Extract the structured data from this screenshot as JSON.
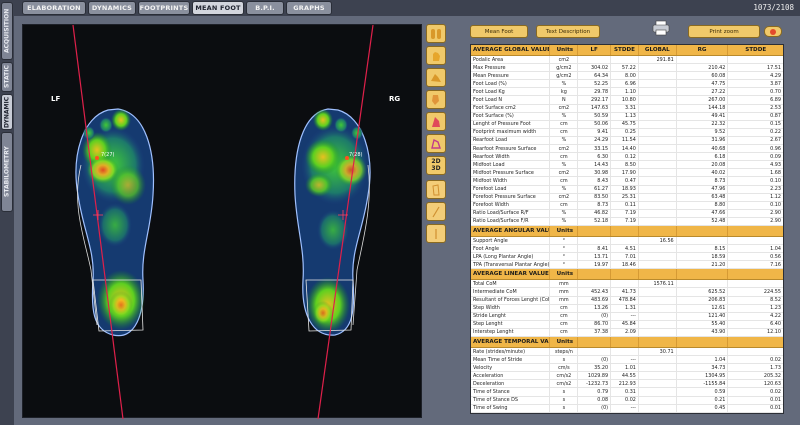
{
  "side_tabs": [
    {
      "label": "ACQUISITION",
      "active": false
    },
    {
      "label": "STATIC",
      "active": false
    },
    {
      "label": "DYNAMIC",
      "active": true
    },
    {
      "label": "STABILOMETRY",
      "active": false
    }
  ],
  "top_tabs": [
    {
      "label": "ELABORATION",
      "active": false
    },
    {
      "label": "DYNAMICS",
      "active": false
    },
    {
      "label": "FOOTPRINTS",
      "active": false
    },
    {
      "label": "MEAN FOOT",
      "active": true
    },
    {
      "label": "B.P.I.",
      "active": false
    },
    {
      "label": "GRAPHS",
      "active": false
    }
  ],
  "frame_counter": "1073/2108",
  "footprint_view": {
    "left_label": "LF",
    "right_label": "RG",
    "left_marker": "7(27)",
    "right_marker": "7(28)"
  },
  "buttons": {
    "mean_foot": "Mean Foot",
    "text_description": "Text Description",
    "print_zoom": "Print zoom",
    "view_2d": "2D",
    "view_3d": "3D"
  },
  "table": {
    "sections": [
      {
        "title": "AVERAGE GLOBAL VALUE",
        "columns": [
          "Units",
          "LF",
          "STDDE",
          "GLOBAL",
          "RG",
          "STDDE"
        ],
        "rows": [
          [
            "Podalic Area",
            "cm2",
            "",
            "",
            "291.81",
            "",
            ""
          ],
          [
            "Max Pressure",
            "g/cm2",
            "304.02",
            "57.22",
            "",
            "210.42",
            "17.51"
          ],
          [
            "Mean Pressure",
            "g/cm2",
            "64.34",
            "8.00",
            "",
            "60.08",
            "4.29"
          ],
          [
            "Foot Load (%)",
            "%",
            "52.25",
            "6.96",
            "",
            "47.75",
            "3.87"
          ],
          [
            "Foot Load Kg",
            "kg",
            "29.78",
            "1.10",
            "",
            "27.22",
            "0.70"
          ],
          [
            "Foot Load N",
            "N",
            "292.17",
            "10.80",
            "",
            "267.00",
            "6.89"
          ],
          [
            "Foot Surface cm2",
            "cm2",
            "147.63",
            "3.31",
            "",
            "144.18",
            "2.53"
          ],
          [
            "Foot Surface (%)",
            "%",
            "50.59",
            "1.13",
            "",
            "49.41",
            "0.87"
          ],
          [
            "Lenght of Pressure Foot",
            "cm",
            "50.06",
            "45.75",
            "",
            "22.32",
            "0.15"
          ],
          [
            "Footprint maximum width",
            "cm",
            "9.41",
            "0.25",
            "",
            "9.52",
            "0.22"
          ],
          [
            "Rearfoot Load",
            "%",
            "24.29",
            "11.54",
            "",
            "31.96",
            "2.67"
          ],
          [
            "Rearfoot Pressure Surface",
            "cm2",
            "33.15",
            "14.40",
            "",
            "40.68",
            "0.96"
          ],
          [
            "Rearfoot Width",
            "cm",
            "6.30",
            "0.12",
            "",
            "6.18",
            "0.09"
          ],
          [
            "Midfoot Load",
            "%",
            "14.43",
            "8.50",
            "",
            "20.08",
            "4.93"
          ],
          [
            "Midfoot Pressure Surface",
            "cm2",
            "30.98",
            "17.90",
            "",
            "40.02",
            "1.68"
          ],
          [
            "Midfoot Width",
            "cm",
            "8.43",
            "0.47",
            "",
            "8.73",
            "0.10"
          ],
          [
            "Forefoot Load",
            "%",
            "61.27",
            "18.93",
            "",
            "47.96",
            "2.23"
          ],
          [
            "Forefoot Pressure Surface",
            "cm2",
            "83.50",
            "25.31",
            "",
            "63.48",
            "1.12"
          ],
          [
            "Forefoot Width",
            "cm",
            "8.73",
            "0.11",
            "",
            "8.80",
            "0.10"
          ],
          [
            "Ratio Load/Surface R/F",
            "%",
            "46.82",
            "7.19",
            "",
            "47.66",
            "2.90"
          ],
          [
            "Ratio Load/Surface F/R",
            "%",
            "52.18",
            "7.19",
            "",
            "52.48",
            "2.90"
          ]
        ]
      },
      {
        "title": "AVERAGE ANGULAR VALU",
        "columns": [
          "Units",
          "",
          "",
          "",
          "",
          ""
        ],
        "rows": [
          [
            "Support Angle",
            "°",
            "",
            "",
            "16.56",
            "",
            ""
          ],
          [
            "Foot Angle",
            "°",
            "8.41",
            "4.51",
            "",
            "8.15",
            "1.04"
          ],
          [
            "LPA (Long Plantar Angle)",
            "°",
            "13.71",
            "7.01",
            "",
            "18.59",
            "0.56"
          ],
          [
            "TPA (Transversal Plantar Angle)",
            "°",
            "19.97",
            "18.46",
            "",
            "21.20",
            "7.16"
          ]
        ]
      },
      {
        "title": "AVERAGE LINEAR VALUES",
        "columns": [
          "Units",
          "",
          "",
          "",
          "",
          ""
        ],
        "rows": [
          [
            "Total CoM",
            "mm",
            "",
            "",
            "1576.11",
            "",
            ""
          ],
          [
            "Intermediate CoM",
            "mm",
            "452.43",
            "41.73",
            "",
            "625.52",
            "224.55"
          ],
          [
            "Resultant of Forces Lenght (CoF)",
            "mm",
            "483.69",
            "478.84",
            "",
            "206.83",
            "8.52"
          ],
          [
            "Step Width",
            "cm",
            "13.26",
            "1.31",
            "",
            "12.61",
            "1.23"
          ],
          [
            "Stride Lenght",
            "cm",
            "(0)",
            "---",
            "",
            "121.40",
            "4.22"
          ],
          [
            "Step Lenght",
            "cm",
            "86.70",
            "45.84",
            "",
            "55.40",
            "6.40"
          ],
          [
            "Interstep Lenght",
            "cm",
            "37.38",
            "2.09",
            "",
            "43.90",
            "12.10"
          ]
        ]
      },
      {
        "title": "AVERAGE TEMPORAL VAL",
        "columns": [
          "Units",
          "",
          "",
          "",
          "",
          ""
        ],
        "rows": [
          [
            "Rate (strides/minute)",
            "steps/n",
            "",
            "",
            "30.71",
            "",
            ""
          ],
          [
            "Mean Time of Stride",
            "s",
            "(0)",
            "---",
            "",
            "1.04",
            "0.02"
          ],
          [
            "Velocity",
            "cm/s",
            "35.20",
            "1.01",
            "",
            "34.73",
            "1.73"
          ],
          [
            "Acceleration",
            "cm/s2",
            "1029.89",
            "44.55",
            "",
            "1304.95",
            "205.32"
          ],
          [
            "Deceleration",
            "cm/s2",
            "-1232.73",
            "212.93",
            "",
            "-1155.84",
            "120.63"
          ],
          [
            "Time of Stance",
            "s",
            "0.79",
            "0.31",
            "",
            "0.59",
            "0.02"
          ],
          [
            "Time of Stance DS",
            "s",
            "0.08",
            "0.02",
            "",
            "0.21",
            "0.01"
          ],
          [
            "Time of Swing",
            "s",
            "(0)",
            "---",
            "",
            "0.45",
            "0.01"
          ]
        ]
      }
    ]
  },
  "colors": {
    "accent": "#f0c96a",
    "section_header": "#f0b648",
    "axis_line": "#e0204a"
  }
}
